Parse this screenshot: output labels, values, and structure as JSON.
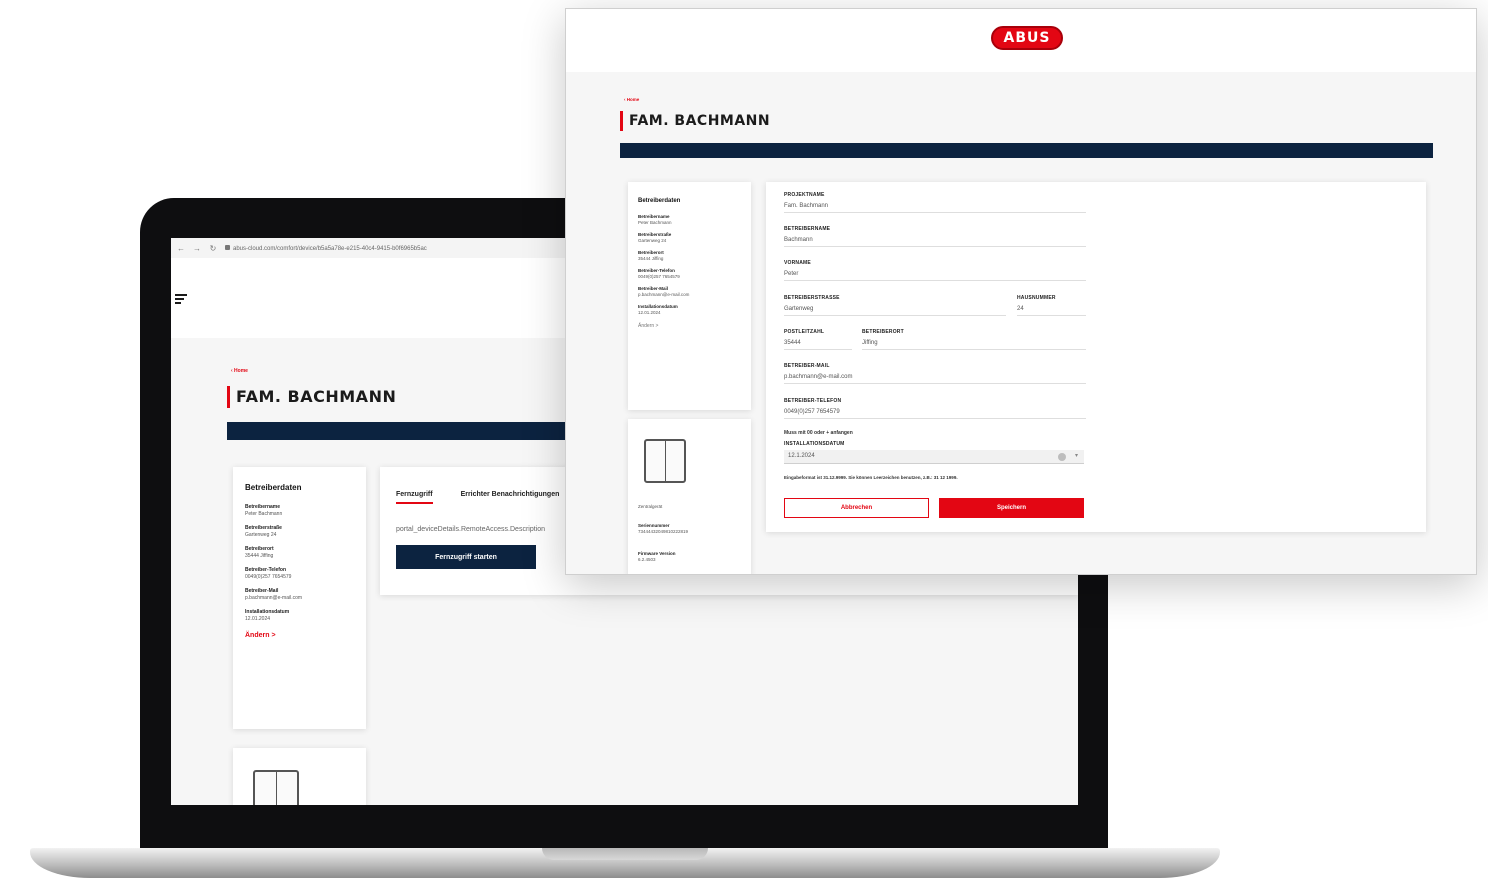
{
  "laptop": {
    "url": "abus-cloud.com/comfort/device/b5a5a78e-e215-40c4-9415-b0f6965b5ac",
    "breadcrumb": "‹ Home",
    "title": "FAM. BACHMANN",
    "sidebar": {
      "heading": "Betreiberdaten",
      "items": [
        {
          "label": "Betreibername",
          "value": "Peter Bachmann"
        },
        {
          "label": "Betreiberstraße",
          "value": "Gartenweg 24"
        },
        {
          "label": "Betreiberort",
          "value": "35444 Jiffing"
        },
        {
          "label": "Betreiber-Telefon",
          "value": "0049(0)257 7654579"
        },
        {
          "label": "Betreiber-Mail",
          "value": "p.bachmann@e-mail.com"
        },
        {
          "label": "Installationsdatum",
          "value": "12.01.2024"
        }
      ],
      "edit": "Ändern >"
    },
    "tabs": [
      "Fernzugriff",
      "Errichter Benachrichtigungen"
    ],
    "remote_desc": "portal_deviceDetails.RemoteAccess.Description",
    "remote_button": "Fernzugriff starten"
  },
  "overlay": {
    "logo": "ABUS",
    "breadcrumb": "‹ Home",
    "title": "FAM. BACHMANN",
    "sidebar": {
      "heading": "Betreiberdaten",
      "items": [
        {
          "label": "Betreibername",
          "value": "Peter Bachmann"
        },
        {
          "label": "Betreiberstraße",
          "value": "Gartenweg 24"
        },
        {
          "label": "Betreiberort",
          "value": "35444 Jiffing"
        },
        {
          "label": "Betreiber-Telefon",
          "value": "0049(0)257 7654579"
        },
        {
          "label": "Betreiber-Mail",
          "value": "p.bachmann@e-mail.com"
        },
        {
          "label": "Installationsdatum",
          "value": "12.01.2024"
        }
      ],
      "edit": "Ändern >"
    },
    "device": {
      "name": "Zentralgerät",
      "serial_label": "Seriennummer",
      "serial_value": "73444432049810222819",
      "firmware_label": "Firmware Version",
      "firmware_value": "6.2.4503"
    },
    "form": {
      "project_label": "PROJEKTNAME",
      "project_value": "Fam. Bachmann",
      "lastname_label": "BETREIBERNAME",
      "lastname_value": "Bachmann",
      "firstname_label": "VORNAME",
      "firstname_value": "Peter",
      "street_label": "BETREIBERSTRASSE",
      "street_value": "Gartenweg",
      "housenr_label": "HAUSNUMMER",
      "housenr_value": "24",
      "zip_label": "POSTLEITZAHL",
      "zip_value": "35444",
      "city_label": "BETREIBERORT",
      "city_value": "Jiffing",
      "mail_label": "BETREIBER-MAIL",
      "mail_value": "p.bachmann@e-mail.com",
      "phone_label": "BETREIBER-TELEFON",
      "phone_value": "0049(0)257 7654579",
      "phone_hint": "Muss mit 00 oder + anfangen",
      "date_label": "INSTALLATIONSDATUM",
      "date_value": "12.1.2024",
      "date_hint": "Eingabeformat ist 31.12.9999. Sie können Leerzeichen benutzen, z.B.: 31 12 1999.",
      "cancel": "Abbrechen",
      "save": "Speichern"
    }
  }
}
